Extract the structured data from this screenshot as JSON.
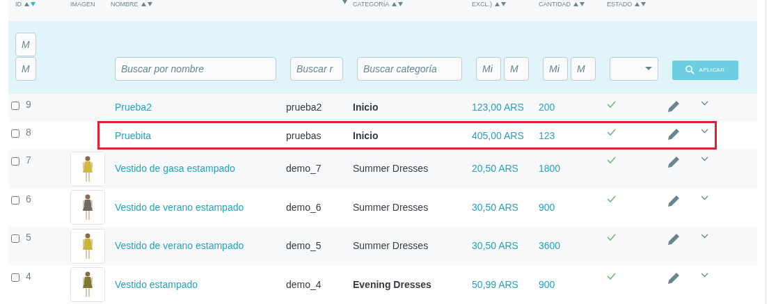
{
  "columns": [
    {
      "label": "ID",
      "up_arrow": true,
      "down_arrow": true,
      "sorted_desc": true
    },
    {
      "label": "IMAGEN",
      "up_arrow": false,
      "down_arrow": false
    },
    {
      "label": "NOMBRE",
      "up_arrow": true,
      "down_arrow": true,
      "sorted_desc": false
    },
    {
      "up_arrow": false,
      "down_arrow": true,
      "sorted_desc": false
    },
    {
      "label": "CATEGORÍA",
      "up_arrow": true,
      "down_arrow": true,
      "sorted_desc": false
    },
    {
      "label": "EXCL.)",
      "up_arrow": true,
      "down_arrow": true,
      "sorted_desc": false
    },
    {
      "label": "CANTIDAD",
      "up_arrow": true,
      "down_arrow": true,
      "sorted_desc": false
    },
    {
      "label": "ESTADO",
      "up_arrow": true,
      "down_arrow": true,
      "sorted_desc": false
    }
  ],
  "filters": {
    "id_min": {
      "placeholder": "M"
    },
    "id_max": {
      "placeholder": "M"
    },
    "name": {
      "placeholder": "Buscar por nombre"
    },
    "reference": {
      "placeholder": "Buscar r"
    },
    "category": {
      "placeholder": "Buscar categoría"
    },
    "price_min": {
      "placeholder": "Mi"
    },
    "price_max": {
      "placeholder": "M"
    },
    "quantity_min": {
      "placeholder": "Mi"
    },
    "quantity_max": {
      "placeholder": "M"
    },
    "apply": "APLICAR"
  },
  "rows": [
    {
      "id": "9",
      "has_image": false,
      "name": "Prueba2",
      "reference": "prueba2",
      "category": "Inicio",
      "category_bold": true,
      "price": "123,00 ARS",
      "quantity": "200",
      "active": true,
      "checked": false,
      "highlighted": false
    },
    {
      "id": "8",
      "has_image": false,
      "name": "Pruebita",
      "reference": "pruebas",
      "category": "Inicio",
      "category_bold": true,
      "price": "405,00 ARS",
      "quantity": "123",
      "active": true,
      "checked": false,
      "highlighted": true
    },
    {
      "id": "7",
      "has_image": true,
      "name": "Vestido de gasa estampado",
      "reference": "demo_7",
      "category": "Summer Dresses",
      "category_bold": false,
      "price": "20,50 ARS",
      "quantity": "1800",
      "active": true,
      "checked": false,
      "highlighted": false
    },
    {
      "id": "6",
      "has_image": true,
      "name": "Vestido de verano estampado",
      "reference": "demo_6",
      "category": "Summer Dresses",
      "category_bold": false,
      "price": "30,50 ARS",
      "quantity": "900",
      "active": true,
      "checked": false,
      "highlighted": false
    },
    {
      "id": "5",
      "has_image": true,
      "name": "Vestido de verano estampado",
      "reference": "demo_5",
      "category": "Summer Dresses",
      "category_bold": false,
      "price": "30,50 ARS",
      "quantity": "3600",
      "active": true,
      "checked": false,
      "highlighted": false
    },
    {
      "id": "4",
      "has_image": true,
      "name": "Vestido estampado",
      "reference": "demo_4",
      "category": "Evening Dresses",
      "category_bold": true,
      "price": "50,99 ARS",
      "quantity": "900",
      "active": true,
      "checked": false,
      "highlighted": false
    }
  ]
}
